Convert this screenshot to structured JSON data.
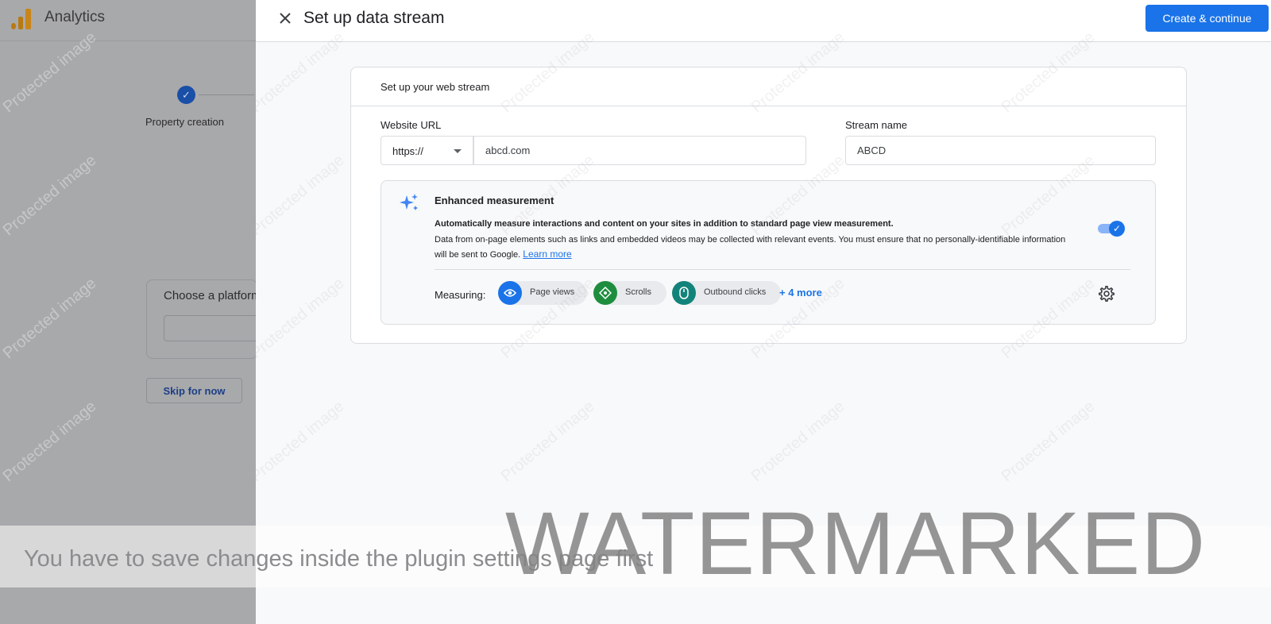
{
  "background": {
    "app_title": "Analytics",
    "step_label": "Property creation",
    "platform_title": "Choose a platform",
    "skip_label": "Skip for now"
  },
  "panel": {
    "title": "Set up data stream",
    "create_label": "Create & continue",
    "card_heading": "Set up your web stream",
    "website_url_label": "Website URL",
    "protocol_value": "https://",
    "url_value": "abcd.com",
    "stream_name_label": "Stream name",
    "stream_name_value": "ABCD",
    "enhanced": {
      "title": "Enhanced measurement",
      "desc_bold": "Automatically measure interactions and content on your sites in addition to standard page view measurement.",
      "desc": "Data from on-page elements such as links and embedded videos may be collected with relevant events. You must ensure that no personally-identifiable information will be sent to Google.",
      "learn_more": "Learn more",
      "enabled": true,
      "measuring_label": "Measuring:",
      "chips": [
        {
          "label": "Page views",
          "color": "#1a73e8",
          "icon": "eye-icon"
        },
        {
          "label": "Scrolls",
          "color": "#1e8e3e",
          "icon": "scroll-icon"
        },
        {
          "label": "Outbound clicks",
          "color": "#12837a",
          "icon": "mouse-icon"
        }
      ],
      "more_link": "+ 4 more"
    }
  },
  "watermark": {
    "tile_text": "Protected image",
    "notice": "You have to save changes inside the plugin settings page first",
    "big": "WATERMARKED"
  },
  "colors": {
    "accent": "#1a73e8",
    "overlay": "#a8a9ab"
  }
}
